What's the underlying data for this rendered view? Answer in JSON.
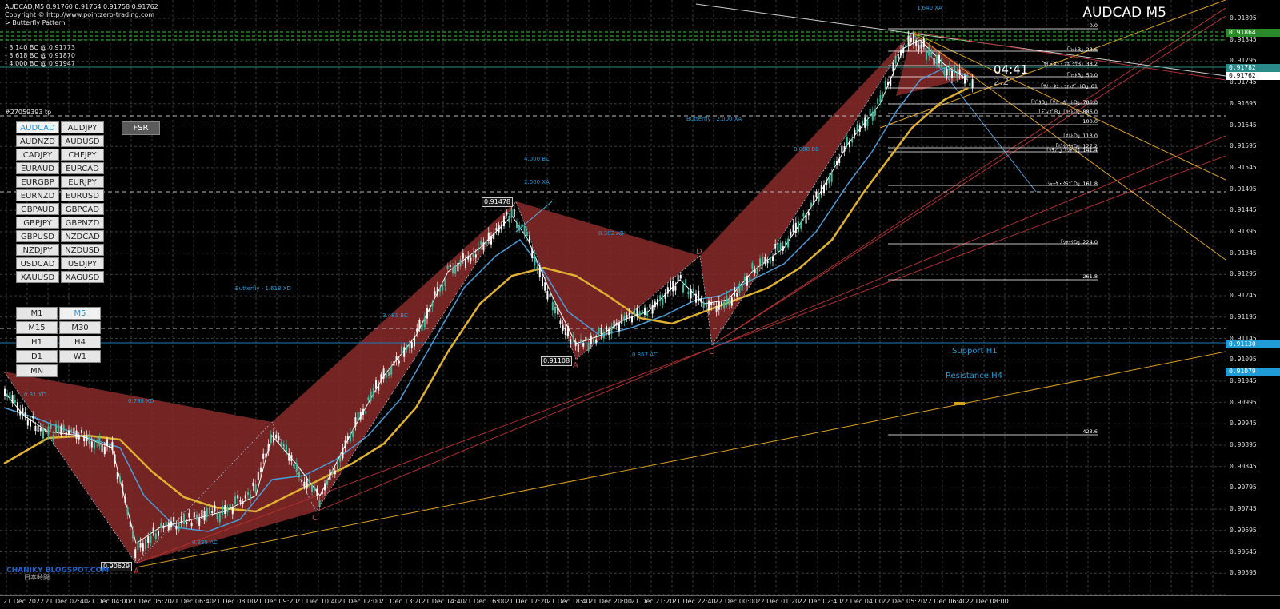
{
  "header": {
    "line1": "AUDCAD,M5  0.91760 0.91764 0.91758 0.91762",
    "line2": "Copyright © http://www.pointzero-trading.com",
    "line3": "> Butterfly Pattern",
    "bc_lines": [
      "- 3.140 BC @ 0.91773",
      "- 3.618 BC @ 0.91870",
      "- 4.000 BC @ 0.91947"
    ],
    "ticket": "#27059393 tp"
  },
  "symbol_title": "AUDCAD M5",
  "pairs": [
    "AUDCAD",
    "AUDJPY",
    "AUDNZD",
    "AUDUSD",
    "CADJPY",
    "CHFJPY",
    "EURAUD",
    "EURCAD",
    "EURGBP",
    "EURJPY",
    "EURNZD",
    "EURUSD",
    "GBPAUD",
    "GBPCAD",
    "GBPJPY",
    "GBPNZD",
    "GBPUSD",
    "NZDCAD",
    "NZDJPY",
    "NZDUSD",
    "USDCAD",
    "USDJPY",
    "XAUUSD",
    "XAGUSD"
  ],
  "active_pair": "AUDCAD",
  "fsr_label": "FSR",
  "timeframes": [
    "M1",
    "M5",
    "M15",
    "M30",
    "H1",
    "H4",
    "D1",
    "W1",
    "MN"
  ],
  "active_timeframe": "M5",
  "price_axis": [
    "0.91895",
    "0.91845",
    "0.91795",
    "0.91745",
    "0.91695",
    "0.91645",
    "0.91595",
    "0.91545",
    "0.91495",
    "0.91445",
    "0.91395",
    "0.91345",
    "0.91295",
    "0.91245",
    "0.91195",
    "0.91145",
    "0.91095",
    "0.91045",
    "0.90995",
    "0.90945",
    "0.90895",
    "0.90845",
    "0.90795",
    "0.90745",
    "0.90695",
    "0.90645",
    "0.90595"
  ],
  "price_tags": [
    {
      "label": "0.91864",
      "color": "#2a8a2a"
    },
    {
      "label": "0.91782",
      "color": "#2a8a8a"
    },
    {
      "label": "0.91762",
      "color": "#ffffff"
    },
    {
      "label": "0.91130",
      "color": "#1f9bd8"
    },
    {
      "label": "0.91079",
      "color": "#1f9bd8"
    }
  ],
  "time_axis": [
    "21 Dec 2022",
    "21 Dec 02:40",
    "21 Dec 04:00",
    "21 Dec 05:20",
    "21 Dec 06:40",
    "21 Dec 08:00",
    "21 Dec 09:20",
    "21 Dec 10:40",
    "21 Dec 12:00",
    "21 Dec 13:20",
    "21 Dec 14:40",
    "21 Dec 16:00",
    "21 Dec 17:20",
    "21 Dec 18:40",
    "21 Dec 20:00",
    "21 Dec 21:20",
    "21 Dec 22:40",
    "22 Dec 00:00",
    "22 Dec 01:20",
    "22 Dec 02:40",
    "22 Dec 04:00",
    "22 Dec 05:20",
    "22 Dec 06:40",
    "22 Dec 08:00"
  ],
  "fib_levels": [
    "0.0",
    "「ﾊｯﾄB」23.6",
    "「ｻｲ・ﾈﾝ・ｵﾎﾞｸｳB」38.2",
    "「ﾊｯﾄB」50.0",
    "「ｻｲ・ﾈﾝ・ﾌｧﾝｶﾞｰﾄB」61",
    "「ﾊﾞﾀB」「ｻｲ・ｶﾞｰﾄD」786.0",
    "「ﾃﾞｨﾌﾟB」「ﾊｯﾄD」886.0",
    "100.0",
    "「ｵﾙﾄD」113.0",
    "「ﾊﾞﾀﾌﾗｲD」127.2",
    "「ｸﾗﾌﾞ」「ｼｬｰｸ」141.4",
    "「ｼｬｰｸ・ｸﾗﾌﾞD」161.8",
    "「ｼｬｰｸD」224.0",
    "261.8",
    "423.6"
  ],
  "annotations": {
    "xa_top": "1.640 XA",
    "bc_1": "4.000 BC",
    "bc_2": "2.000 XA",
    "ab": "0.382 AB",
    "butterfly_2": "Butterfly - 2.000 XA",
    "butterfly_1": "Butterfly - 1.618 XD",
    "bc_3": "3.481 BC",
    "ac": "0.867 AC",
    "xd": "0.788 XD",
    "ac2": "0.825 AC",
    "bb": "0.888 BB",
    "xd_small": "0.81 XD"
  },
  "boxes": {
    "high": "0.91478",
    "low_mid": "0.91108",
    "low": "0.90629"
  },
  "points": {
    "a1": "A",
    "c1": "C",
    "a2": "A",
    "c2": "C",
    "d": "D"
  },
  "timer": "04:41",
  "spread": "2.2",
  "support": "Support H1",
  "resistance": "Resistance H4",
  "watermark": "CHANIKY BLOGSPOT.COM",
  "watermark_sub": "日本時間"
}
